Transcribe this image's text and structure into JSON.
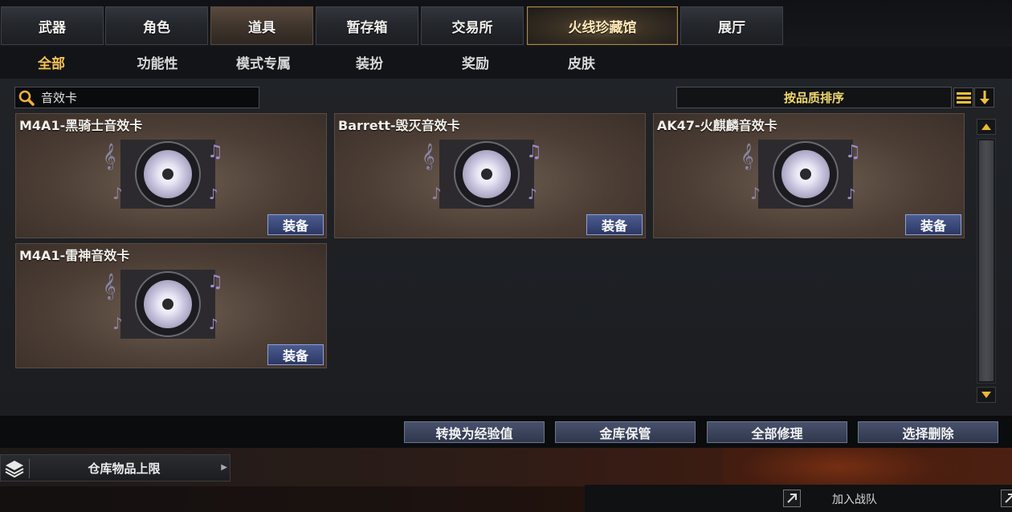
{
  "main_tabs": [
    {
      "label": "武器"
    },
    {
      "label": "角色"
    },
    {
      "label": "道具"
    },
    {
      "label": "暂存箱"
    },
    {
      "label": "交易所"
    },
    {
      "label": "火线珍藏馆"
    },
    {
      "label": "展厅"
    }
  ],
  "active_main_tab": "道具",
  "sub_tabs": [
    {
      "label": "全部"
    },
    {
      "label": "功能性"
    },
    {
      "label": "模式专属"
    },
    {
      "label": "装扮"
    },
    {
      "label": "奖励"
    },
    {
      "label": "皮肤"
    }
  ],
  "active_sub_tab": "全部",
  "search": {
    "value": "音效卡",
    "icon": "search-icon"
  },
  "sort": {
    "label": "按品质排序",
    "icons": [
      "list-icon",
      "sort-down-arrow-icon"
    ]
  },
  "items": [
    {
      "name": "M4A1-黑骑士音效卡",
      "button": "装备"
    },
    {
      "name": "Barrett-毁灭音效卡",
      "button": "装备"
    },
    {
      "name": "AK47-火麒麟音效卡",
      "button": "装备"
    },
    {
      "name": "M4A1-雷神音效卡",
      "button": "装备"
    }
  ],
  "actions": [
    {
      "label": "转换为经验值"
    },
    {
      "label": "金库保管"
    },
    {
      "label": "全部修理"
    },
    {
      "label": "选择删除"
    }
  ],
  "storage": {
    "label": "仓库物品上限"
  },
  "footer": {
    "join_label": "加入战队"
  },
  "colors": {
    "accent_gold": "#f4c252",
    "sort_text": "#f1d96d",
    "button_blue": "#3a4678"
  }
}
